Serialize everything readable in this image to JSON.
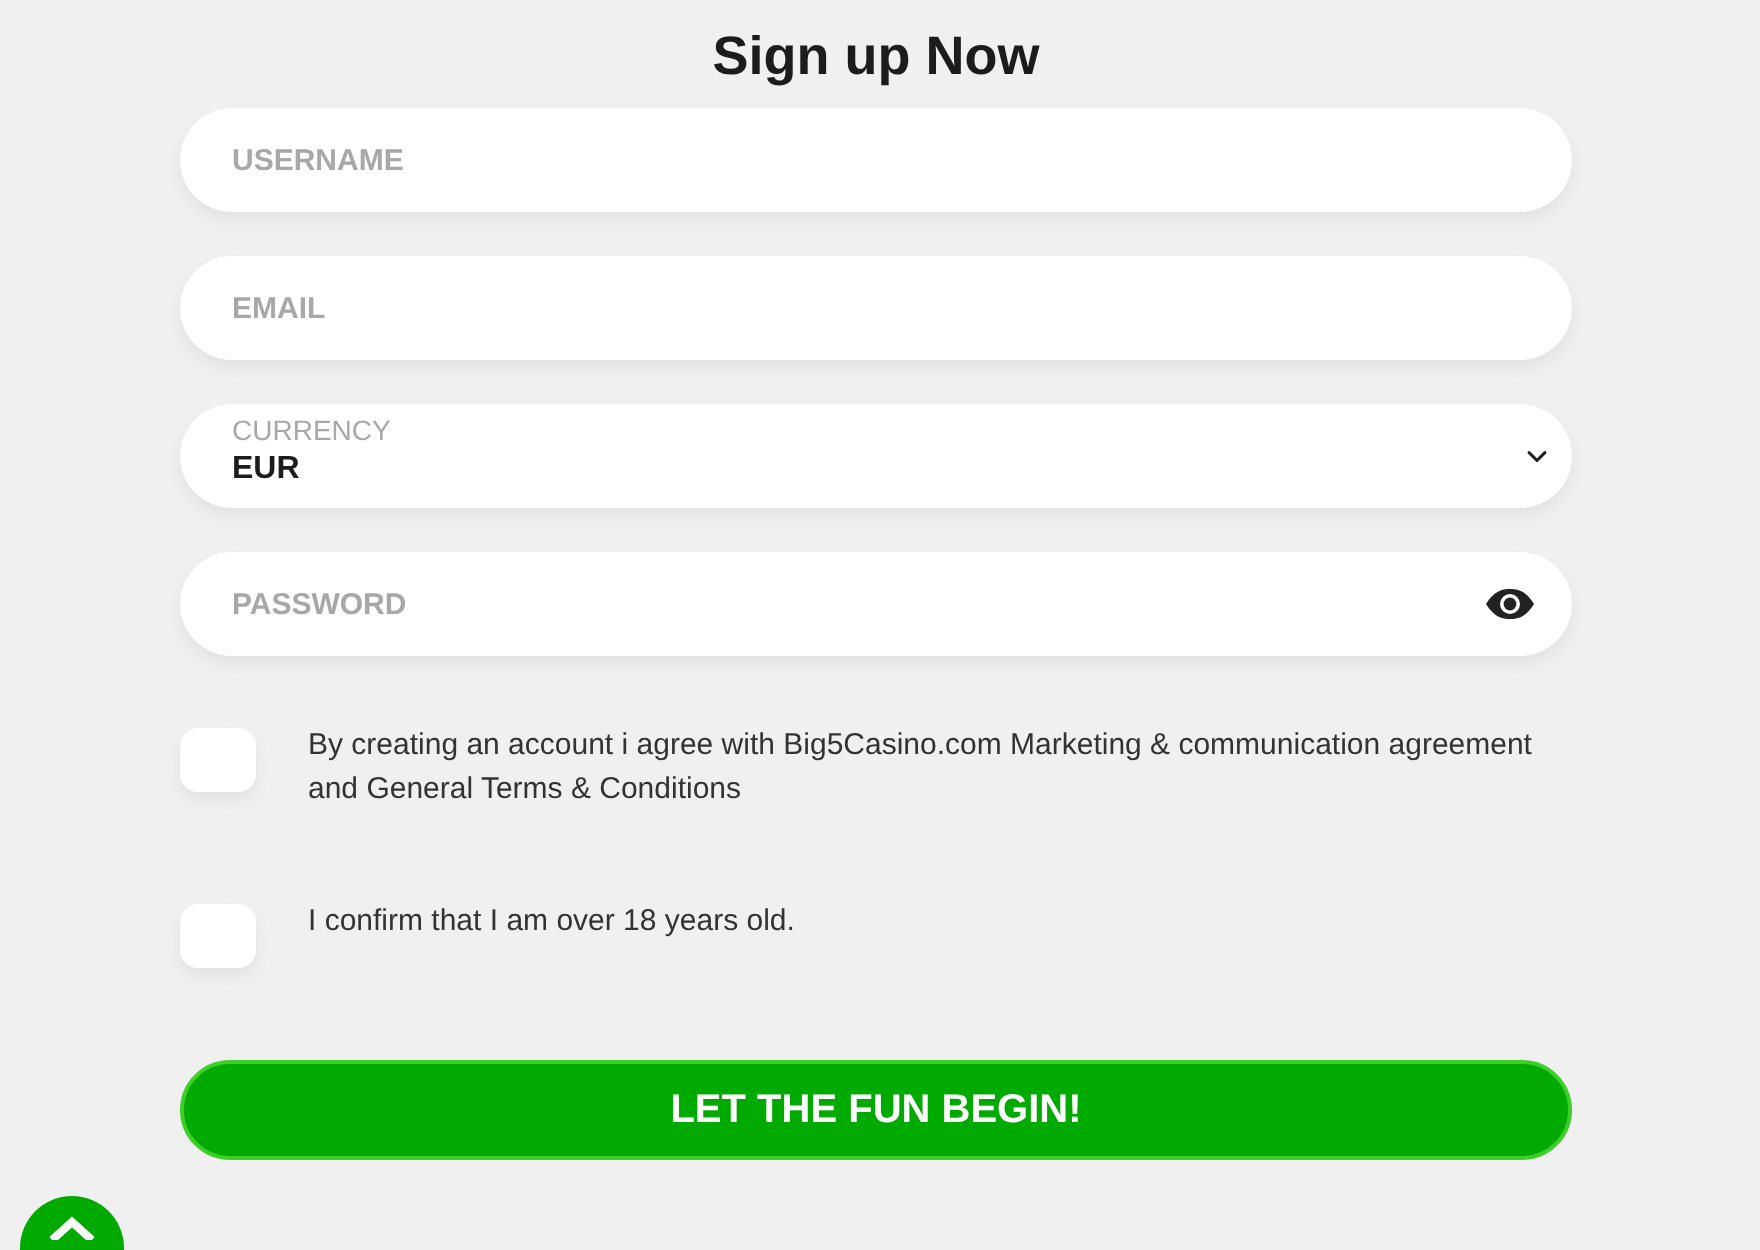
{
  "heading": "Sign up Now",
  "fields": [
    {
      "kind": "text",
      "placeholder": "USERNAME"
    },
    {
      "kind": "text",
      "placeholder": "EMAIL"
    },
    {
      "kind": "select",
      "label": "CURRENCY",
      "value": "EUR"
    },
    {
      "kind": "password",
      "placeholder": "PASSWORD"
    }
  ],
  "agreements": [
    {
      "text": "By creating an account i agree with Big5Casino.com Marketing & communication agreement and General Terms & Conditions",
      "checked": false
    },
    {
      "text": "I confirm that I am over 18 years old.",
      "checked": false
    }
  ],
  "submit": {
    "label": "LET THE FUN BEGIN!"
  }
}
